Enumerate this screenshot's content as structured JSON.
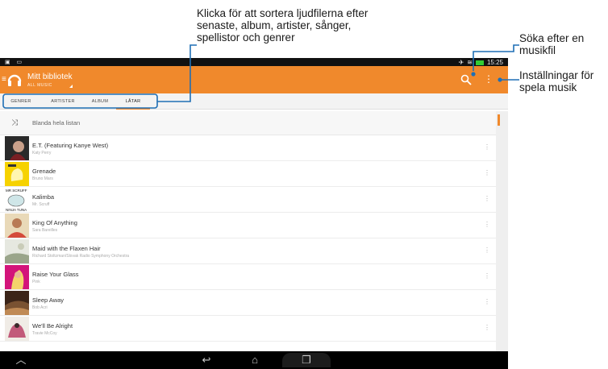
{
  "callouts": {
    "sort": [
      "Klicka för att sortera ljudfilerna efter",
      "senaste, album, artister, sånger,",
      "spellistor och genrer"
    ],
    "search": [
      "Söka efter en",
      "musikfil"
    ],
    "settings": [
      "Inställningar för",
      "spela musik"
    ]
  },
  "status_bar": {
    "time": "15:25",
    "left_icons": "▣ ▭"
  },
  "action_bar": {
    "title": "Mitt bibliotek",
    "subtitle": "ALL MUSIC",
    "accent_color": "#f0892c",
    "icons": [
      "headphones-icon",
      "search-icon",
      "overflow-menu-icon"
    ]
  },
  "tabs": [
    {
      "label": "GENRER"
    },
    {
      "label": "ARTISTER"
    },
    {
      "label": "ALBUM"
    },
    {
      "label": "LÅTAR",
      "active": true
    }
  ],
  "shuffle": {
    "label": "Blanda hela listan",
    "icon": "shuffle-icon"
  },
  "songs": [
    {
      "title": "E.T. (Featuring Kanye West)",
      "artist": "Katy Perry"
    },
    {
      "title": "Grenade",
      "artist": "Bruno Mars"
    },
    {
      "title": "Kalimba",
      "artist": "Mr. Scruff"
    },
    {
      "title": "King Of Anything",
      "artist": "Sara Bareilles"
    },
    {
      "title": "Maid with the Flaxen Hair",
      "artist": "Richard Stoltzman/Slovak Radio Symphony Orchestra"
    },
    {
      "title": "Raise Your Glass",
      "artist": "Pink"
    },
    {
      "title": "Sleep Away",
      "artist": "Bob Acri"
    },
    {
      "title": "We'll Be Alright",
      "artist": "Travie McCoy"
    }
  ],
  "album_art_text": {
    "kalimba_top": "MR SCRUFF",
    "kalimba_bottom": "NINJA TUNA"
  },
  "navbar": {
    "icons": [
      "collapse-up-icon",
      "back-icon",
      "home-icon",
      "recent-apps-icon"
    ]
  }
}
